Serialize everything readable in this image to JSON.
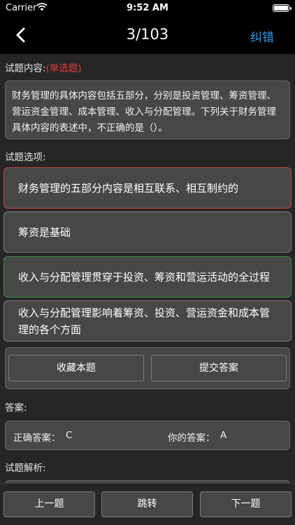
{
  "status": {
    "carrier": "Carrier",
    "time": "9:52 AM"
  },
  "nav": {
    "progress": "3/103",
    "report_label": "纠错"
  },
  "question": {
    "label": "试题内容:",
    "type": "(单选题)",
    "text": "财务管理的具体内容包括五部分，分别是投资管理、筹资管理、营运资金管理、成本管理、收入与分配管理。下列关于财务管理具体内容的表述中，不正确的是（）。"
  },
  "options_label": "试题选项:",
  "options": [
    {
      "text": "财务管理的五部分内容是相互联系、相互制约的",
      "state": "wrong"
    },
    {
      "text": "筹资是基础",
      "state": "normal"
    },
    {
      "text": "收入与分配管理贯穿于投资、筹资和营运活动的全过程",
      "state": "right"
    },
    {
      "text": "收入与分配管理影响着筹资、投资、营运资金和成本管理的各个方面",
      "state": "normal"
    }
  ],
  "actions": {
    "favorite": "收藏本题",
    "submit": "提交答案"
  },
  "answer": {
    "label": "答案:",
    "correct_label": "正确答案：",
    "correct_value": "C",
    "yours_label": "你的答案：",
    "yours_value": "A"
  },
  "analysis_label": "试题解析:",
  "bottom": {
    "prev": "上一题",
    "jump": "跳转",
    "next": "下一题"
  },
  "colors": {
    "accent": "#2f9bf3",
    "wrong_border": "#c94444",
    "right_border": "#3e8f3e",
    "type_tag": "#e23b3b"
  }
}
